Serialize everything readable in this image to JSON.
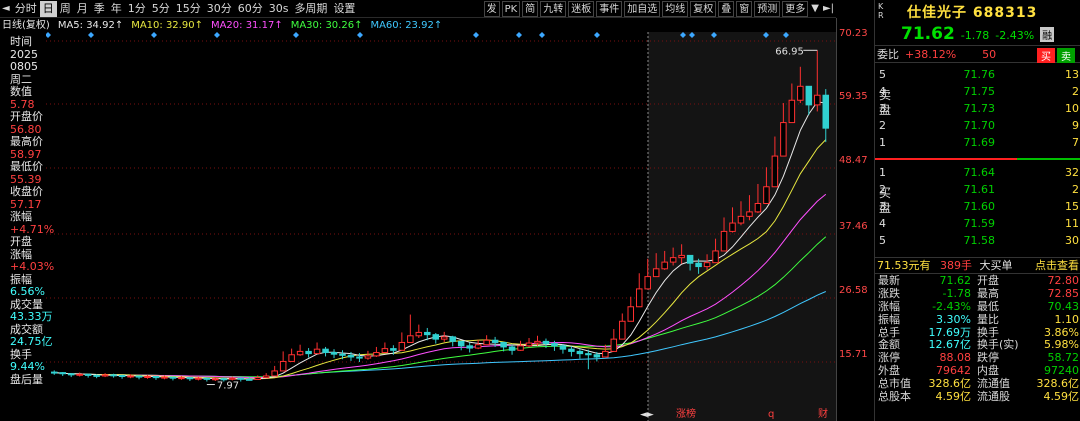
{
  "toolbar": {
    "left_items": [
      "分时",
      "日",
      "周",
      "月",
      "季",
      "年",
      "1分",
      "5分",
      "15分",
      "30分",
      "60分",
      "30s",
      "多周期",
      "设置"
    ],
    "active_item": "日",
    "right_items": [
      "发",
      "PK",
      "简",
      "九转",
      "迷板",
      "事件",
      "加自选",
      "均线",
      "复权",
      "叠",
      "窗",
      "预测",
      "更多"
    ]
  },
  "ma_legend": {
    "title": "日线(复权)",
    "ma5": "MA5: 34.92↑",
    "ma10": "MA10: 32.90↑",
    "ma20": "MA20: 31.17↑",
    "ma30": "MA30: 30.26↑",
    "ma60": "MA60: 23.92↑",
    "colors": {
      "ma5": "#e8e8e8",
      "ma10": "#e8e840",
      "ma20": "#ff50ff",
      "ma30": "#40ff40",
      "ma60": "#40c8ff"
    }
  },
  "left_info": [
    {
      "text": "时间",
      "cls": "lv-white"
    },
    {
      "text": "2025",
      "cls": "lv-white"
    },
    {
      "text": "0805",
      "cls": "lv-white"
    },
    {
      "text": "周二",
      "cls": "lv-white"
    },
    {
      "text": "数值",
      "cls": "lv-white"
    },
    {
      "text": "5.78",
      "cls": "lv-red"
    },
    {
      "text": "开盘价",
      "cls": "lv-white"
    },
    {
      "text": "56.80",
      "cls": "lv-red"
    },
    {
      "text": "最高价",
      "cls": "lv-white"
    },
    {
      "text": "58.97",
      "cls": "lv-red"
    },
    {
      "text": "最低价",
      "cls": "lv-white"
    },
    {
      "text": "55.39",
      "cls": "lv-red"
    },
    {
      "text": "收盘价",
      "cls": "lv-white"
    },
    {
      "text": "57.17",
      "cls": "lv-red"
    },
    {
      "text": "涨幅",
      "cls": "lv-white"
    },
    {
      "text": "+4.71%",
      "cls": "lv-red"
    },
    {
      "text": "开盘",
      "cls": "lv-white"
    },
    {
      "text": "涨幅",
      "cls": "lv-white"
    },
    {
      "text": "+4.03%",
      "cls": "lv-red"
    },
    {
      "text": "振幅",
      "cls": "lv-white"
    },
    {
      "text": "6.56%",
      "cls": "lv-cyan"
    },
    {
      "text": "成交量",
      "cls": "lv-white"
    },
    {
      "text": "43.33万",
      "cls": "lv-cyan"
    },
    {
      "text": "成交额",
      "cls": "lv-white"
    },
    {
      "text": "24.75亿",
      "cls": "lv-cyan"
    },
    {
      "text": "换手",
      "cls": "lv-white"
    },
    {
      "text": "9.44%",
      "cls": "lv-cyan"
    },
    {
      "text": "盘后量",
      "cls": "lv-white"
    }
  ],
  "axis": {
    "labels": [
      "70.23",
      "59.35",
      "48.47",
      "37.46",
      "26.58",
      "15.71"
    ]
  },
  "chart_data": {
    "type": "candlestick",
    "ylim": [
      4.83,
      70.23
    ],
    "high_label": "66.95",
    "low_label": "7.97",
    "bottom_markers": [
      "涨榜",
      "q",
      "财"
    ],
    "closes": [
      9.2,
      9.0,
      8.8,
      8.9,
      8.7,
      8.6,
      8.8,
      8.7,
      8.5,
      8.6,
      8.4,
      8.5,
      8.3,
      8.4,
      8.2,
      8.3,
      8.1,
      8.2,
      8.0,
      8.1,
      8.0,
      8.2,
      8.0,
      7.97,
      8.3,
      8.6,
      9.5,
      11.2,
      12.4,
      13.0,
      12.6,
      13.4,
      12.8,
      12.5,
      12.3,
      12.0,
      11.8,
      12.2,
      12.8,
      13.5,
      13.2,
      14.6,
      15.8,
      16.4,
      16.0,
      15.2,
      15.6,
      14.8,
      14.0,
      13.6,
      14.2,
      15.0,
      14.6,
      13.8,
      13.2,
      14.0,
      14.5,
      14.8,
      14.4,
      14.0,
      13.4,
      13.0,
      12.6,
      12.4,
      12.0,
      13.0,
      15.2,
      18.4,
      21.0,
      24.2,
      26.4,
      27.8,
      29.0,
      29.8,
      30.2,
      28.8,
      28.2,
      28.9,
      31.0,
      34.5,
      36.0,
      37.2,
      38.0,
      39.5,
      42.5,
      48.0,
      54.0,
      58.0,
      60.5,
      57.17,
      58.9,
      53.0
    ],
    "highs": [
      9.6,
      9.3,
      9.1,
      9.2,
      9.0,
      8.9,
      9.1,
      9.0,
      8.8,
      8.9,
      8.7,
      8.8,
      8.6,
      8.7,
      8.5,
      8.6,
      8.4,
      8.5,
      8.3,
      8.4,
      8.3,
      8.5,
      8.3,
      8.4,
      8.7,
      9.1,
      10.4,
      13.0,
      13.5,
      14.2,
      13.6,
      14.6,
      13.8,
      13.4,
      13.2,
      12.9,
      12.7,
      13.1,
      13.8,
      14.6,
      14.1,
      16.4,
      19.6,
      17.8,
      17.2,
      16.3,
      16.5,
      15.8,
      14.9,
      14.6,
      15.1,
      15.9,
      15.6,
      14.7,
      14.2,
      14.9,
      15.4,
      15.8,
      15.3,
      14.9,
      14.3,
      13.9,
      13.5,
      13.3,
      12.9,
      14.2,
      17.0,
      19.8,
      22.8,
      27.0,
      29.6,
      30.6,
      31.0,
      31.6,
      32.2,
      30.2,
      29.6,
      30.4,
      33.2,
      37.0,
      38.8,
      39.9,
      41.0,
      43.0,
      46.0,
      51.5,
      57.5,
      61.0,
      64.0,
      58.97,
      66.95,
      60.0
    ],
    "lows": [
      8.8,
      8.6,
      8.4,
      8.5,
      8.3,
      8.2,
      8.4,
      8.3,
      8.1,
      8.2,
      8.0,
      8.1,
      7.9,
      8.0,
      7.8,
      7.9,
      7.7,
      7.8,
      7.6,
      7.7,
      7.6,
      7.8,
      7.6,
      7.97,
      8.0,
      8.2,
      8.9,
      10.6,
      11.8,
      12.2,
      11.9,
      12.6,
      12.1,
      11.8,
      11.6,
      11.3,
      11.1,
      11.5,
      12.0,
      12.8,
      12.4,
      13.8,
      15.0,
      15.4,
      15.0,
      14.4,
      14.7,
      13.9,
      13.2,
      12.8,
      13.4,
      14.2,
      13.8,
      13.0,
      12.4,
      13.1,
      13.7,
      14.0,
      13.6,
      13.1,
      12.6,
      12.1,
      11.7,
      9.8,
      11.2,
      12.1,
      14.3,
      17.2,
      19.8,
      22.8,
      25.0,
      26.4,
      27.6,
      28.4,
      28.7,
      27.5,
      26.9,
      27.6,
      29.6,
      32.8,
      34.3,
      35.6,
      36.5,
      37.8,
      40.2,
      45.6,
      51.4,
      55.4,
      57.5,
      55.39,
      56.0,
      50.5
    ]
  },
  "panel": {
    "kr": "K R",
    "stock_name": "仕佳光子  688313",
    "price": "71.62",
    "change": "-1.78",
    "change_pct": "-2.43%",
    "tag": "融",
    "weibi_label": "委比",
    "weibi_value": "+38.12%",
    "weibi_diff": "50",
    "buy_btn": "买",
    "sell_btn": "卖",
    "sell_side_label": "卖\n盘",
    "buy_side_label": "买\n盘",
    "asks": [
      {
        "level": "5",
        "price": "71.76",
        "vol": "13"
      },
      {
        "level": "4",
        "price": "71.75",
        "vol": "2"
      },
      {
        "level": "3",
        "price": "71.73",
        "vol": "10"
      },
      {
        "level": "2",
        "price": "71.70",
        "vol": "9"
      },
      {
        "level": "1",
        "price": "71.69",
        "vol": "7"
      }
    ],
    "bids": [
      {
        "level": "1",
        "price": "71.64",
        "vol": "32"
      },
      {
        "level": "2",
        "price": "71.61",
        "vol": "2"
      },
      {
        "level": "3",
        "price": "71.60",
        "vol": "15"
      },
      {
        "level": "4",
        "price": "71.59",
        "vol": "11"
      },
      {
        "level": "5",
        "price": "71.58",
        "vol": "30"
      }
    ],
    "trade_price": "71.53元有",
    "trade_vol": "389手",
    "trade_desc": "大买单",
    "trade_link": "点击查看",
    "stats": [
      {
        "l1": "最新",
        "v1": "71.62",
        "c1": "#00d000",
        "l2": "开盘",
        "v2": "72.80",
        "c2": "#ff4040"
      },
      {
        "l1": "涨跌",
        "v1": "-1.78",
        "c1": "#00d000",
        "l2": "最高",
        "v2": "72.85",
        "c2": "#ff4040"
      },
      {
        "l1": "涨幅",
        "v1": "-2.43%",
        "c1": "#00d000",
        "l2": "最低",
        "v2": "70.43",
        "c2": "#00d000"
      },
      {
        "l1": "振幅",
        "v1": "3.30%",
        "c1": "#40ffff",
        "l2": "量比",
        "v2": "1.10",
        "c2": "#ffe040"
      },
      {
        "l1": "总手",
        "v1": "17.69万",
        "c1": "#40ffff",
        "l2": "换手",
        "v2": "3.86%",
        "c2": "#ffe040"
      },
      {
        "l1": "金额",
        "v1": "12.67亿",
        "c1": "#40ffff",
        "l2": "换手(实)",
        "v2": "5.98%",
        "c2": "#ffe040"
      },
      {
        "l1": "涨停",
        "v1": "88.08",
        "c1": "#ff4040",
        "l2": "跌停",
        "v2": "58.72",
        "c2": "#00d000"
      },
      {
        "l1": "外盘",
        "v1": "79642",
        "c1": "#ff4040",
        "l2": "内盘",
        "v2": "97240",
        "c2": "#00d000"
      },
      {
        "l1": "总市值",
        "v1": "328.6亿",
        "c1": "#ffe040",
        "l2": "流通值",
        "v2": "328.6亿",
        "c2": "#ffe040"
      },
      {
        "l1": "总股本",
        "v1": "4.59亿",
        "c1": "#ffe040",
        "l2": "流通股",
        "v2": "4.59亿",
        "c2": "#ffe040"
      }
    ]
  }
}
